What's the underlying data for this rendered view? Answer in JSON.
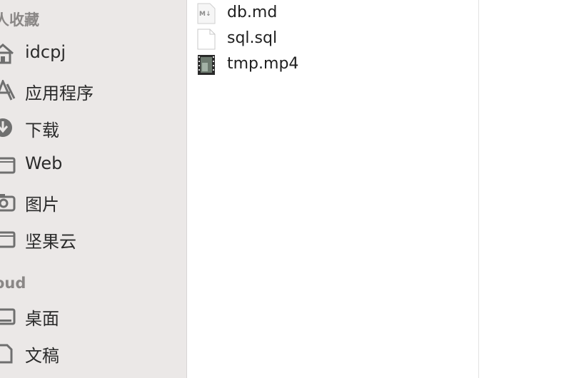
{
  "sidebar": {
    "favorites_header": "人收藏",
    "favorites": [
      {
        "label": "idcpj",
        "icon": "home-icon"
      },
      {
        "label": "应用程序",
        "icon": "applications-icon"
      },
      {
        "label": "下载",
        "icon": "downloads-icon"
      },
      {
        "label": "Web",
        "icon": "folder-icon"
      },
      {
        "label": "图片",
        "icon": "camera-icon"
      },
      {
        "label": "坚果云",
        "icon": "folder-icon"
      }
    ],
    "icloud_header": "oud",
    "icloud": [
      {
        "label": "桌面",
        "icon": "desktop-icon"
      },
      {
        "label": "文稿",
        "icon": "documents-icon"
      }
    ]
  },
  "files": [
    {
      "name": "db.md",
      "icon": "markdown-file-icon"
    },
    {
      "name": "sql.sql",
      "icon": "blank-file-icon"
    },
    {
      "name": "tmp.mp4",
      "icon": "video-file-icon"
    }
  ]
}
